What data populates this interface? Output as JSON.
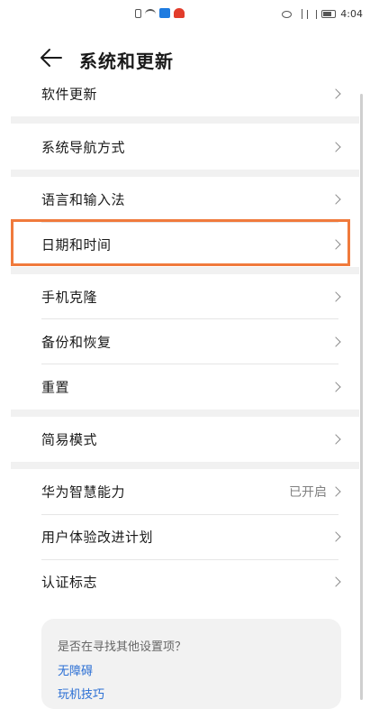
{
  "status_bar": {
    "time": "4:04"
  },
  "header": {
    "title": "系统和更新"
  },
  "items": [
    {
      "label": "软件更新"
    },
    {
      "label": "系统导航方式"
    },
    {
      "label": "语言和输入法"
    },
    {
      "label": "日期和时间"
    },
    {
      "label": "手机克隆"
    },
    {
      "label": "备份和恢复"
    },
    {
      "label": "重置"
    },
    {
      "label": "简易模式"
    },
    {
      "label": "华为智慧能力",
      "value": "已开启"
    },
    {
      "label": "用户体验改进计划"
    },
    {
      "label": "认证标志"
    }
  ],
  "suggestions": {
    "question": "是否在寻找其他设置项？",
    "links": [
      "无障碍",
      "玩机技巧"
    ]
  },
  "colors": {
    "highlight": "#f07a3c",
    "link": "#2b6fd4"
  }
}
